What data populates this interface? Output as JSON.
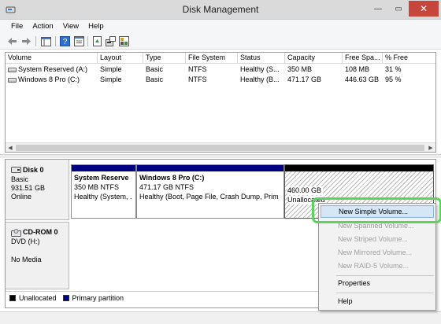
{
  "window": {
    "title": "Disk Management",
    "controls": {
      "minimize": "—",
      "maximize": "▭",
      "close": "✕"
    }
  },
  "menu": [
    "File",
    "Action",
    "View",
    "Help"
  ],
  "volume_list": {
    "columns": [
      "Volume",
      "Layout",
      "Type",
      "File System",
      "Status",
      "Capacity",
      "Free Spa...",
      "% Free"
    ],
    "rows": [
      [
        "System Reserved (A:)",
        "Simple",
        "Basic",
        "NTFS",
        "Healthy (S...",
        "350 MB",
        "108 MB",
        "31 %"
      ],
      [
        "Windows 8 Pro (C:)",
        "Simple",
        "Basic",
        "NTFS",
        "Healthy (B...",
        "471.17 GB",
        "446.63 GB",
        "95 %"
      ]
    ]
  },
  "disks": [
    {
      "name": "Disk 0",
      "lines": [
        "Basic",
        "931.51 GB",
        "Online"
      ],
      "partitions": [
        {
          "title": "System Reserve",
          "size": "350 MB NTFS",
          "status": "Healthy (System, ."
        },
        {
          "title": "Windows 8 Pro  (C:)",
          "size": "471.17 GB NTFS",
          "status": "Healthy (Boot, Page File, Crash Dump, Prim"
        },
        {
          "title": "",
          "size": "460.00 GB",
          "status": "Unallocated"
        }
      ]
    },
    {
      "name": "CD-ROM 0",
      "lines": [
        "DVD (H:)",
        "",
        "No Media"
      ]
    }
  ],
  "legend": [
    {
      "label": "Unallocated",
      "color": "#000000"
    },
    {
      "label": "Primary partition",
      "color": "#000080"
    }
  ],
  "context_menu": {
    "items": [
      {
        "label": "New Simple Volume...",
        "enabled": true,
        "highlighted": true
      },
      {
        "label": "New Spanned Volume...",
        "enabled": false
      },
      {
        "label": "New Striped Volume...",
        "enabled": false
      },
      {
        "label": "New Mirrored Volume...",
        "enabled": false
      },
      {
        "label": "New RAID-5 Volume...",
        "enabled": false
      },
      {
        "label": "Properties",
        "enabled": true
      },
      {
        "label": "Help",
        "enabled": true
      }
    ]
  },
  "colors": {
    "primary_partition": "#000080",
    "unallocated": "#000000",
    "highlight_ring": "#5dd25d",
    "close_button": "#c7463c"
  }
}
